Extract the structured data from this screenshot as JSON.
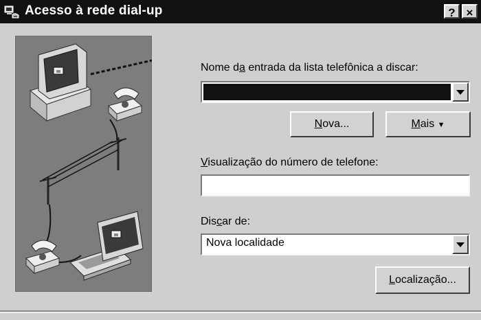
{
  "window": {
    "title": "Acesso à rede dial-up",
    "help_button": "?",
    "close_button": "×"
  },
  "phonebook": {
    "label_pre": "Nome d",
    "label_key": "a",
    "label_post": " entrada da lista telefônica a discar:",
    "selected_value": ""
  },
  "buttons": {
    "new_key": "N",
    "new_rest": "ova...",
    "more_key": "M",
    "more_rest": "ais",
    "more_arrow": "▼",
    "location_key": "L",
    "location_rest": "ocalização..."
  },
  "preview": {
    "label_key": "V",
    "label_rest": "isualização do número de telefone:",
    "value": ""
  },
  "dial_from": {
    "label_pre": "Dis",
    "label_key": "c",
    "label_post": "ar de:",
    "selected_value": "Nova localidade"
  }
}
